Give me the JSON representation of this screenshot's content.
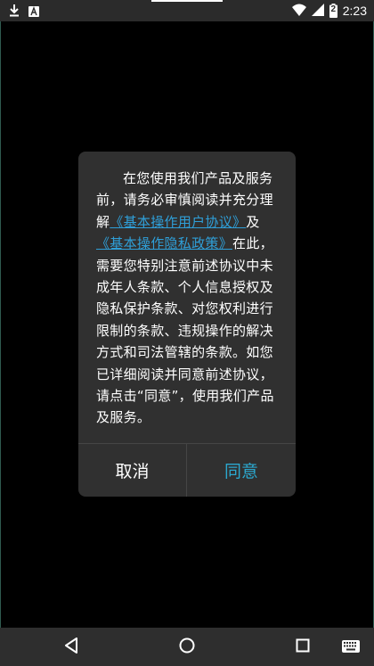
{
  "status_bar": {
    "time": "2:23",
    "battery_level": "2",
    "icons": [
      "download-icon",
      "app-notification-icon",
      "wifi-icon",
      "cellular-signal-icon",
      "battery-charging-icon"
    ]
  },
  "dialog": {
    "message_parts": {
      "intro": "在您使用我们产品及服务前，请务必审慎阅读并充分理解",
      "link_user_agreement": "《基本操作用户协议》",
      "conjunction": "及",
      "link_privacy_policy": "《基本操作隐私政策》",
      "body": "在此，需要您特别注意前述协议中未成年人条款、个人信息授权及隐私保护条款、对您权利进行限制的条款、违规操作的解决方式和司法管辖的条款。如您已详细阅读并同意前述协议，请点击“同意”，使用我们产品及服务。"
    },
    "cancel_label": "取消",
    "agree_label": "同意"
  },
  "colors": {
    "link": "#2f9fd8",
    "agree": "#2ba8cf",
    "dialog_bg": "#303030"
  },
  "nav_bar": {
    "icons": [
      "back-icon",
      "home-icon",
      "recents-icon",
      "keyboard-icon"
    ]
  }
}
